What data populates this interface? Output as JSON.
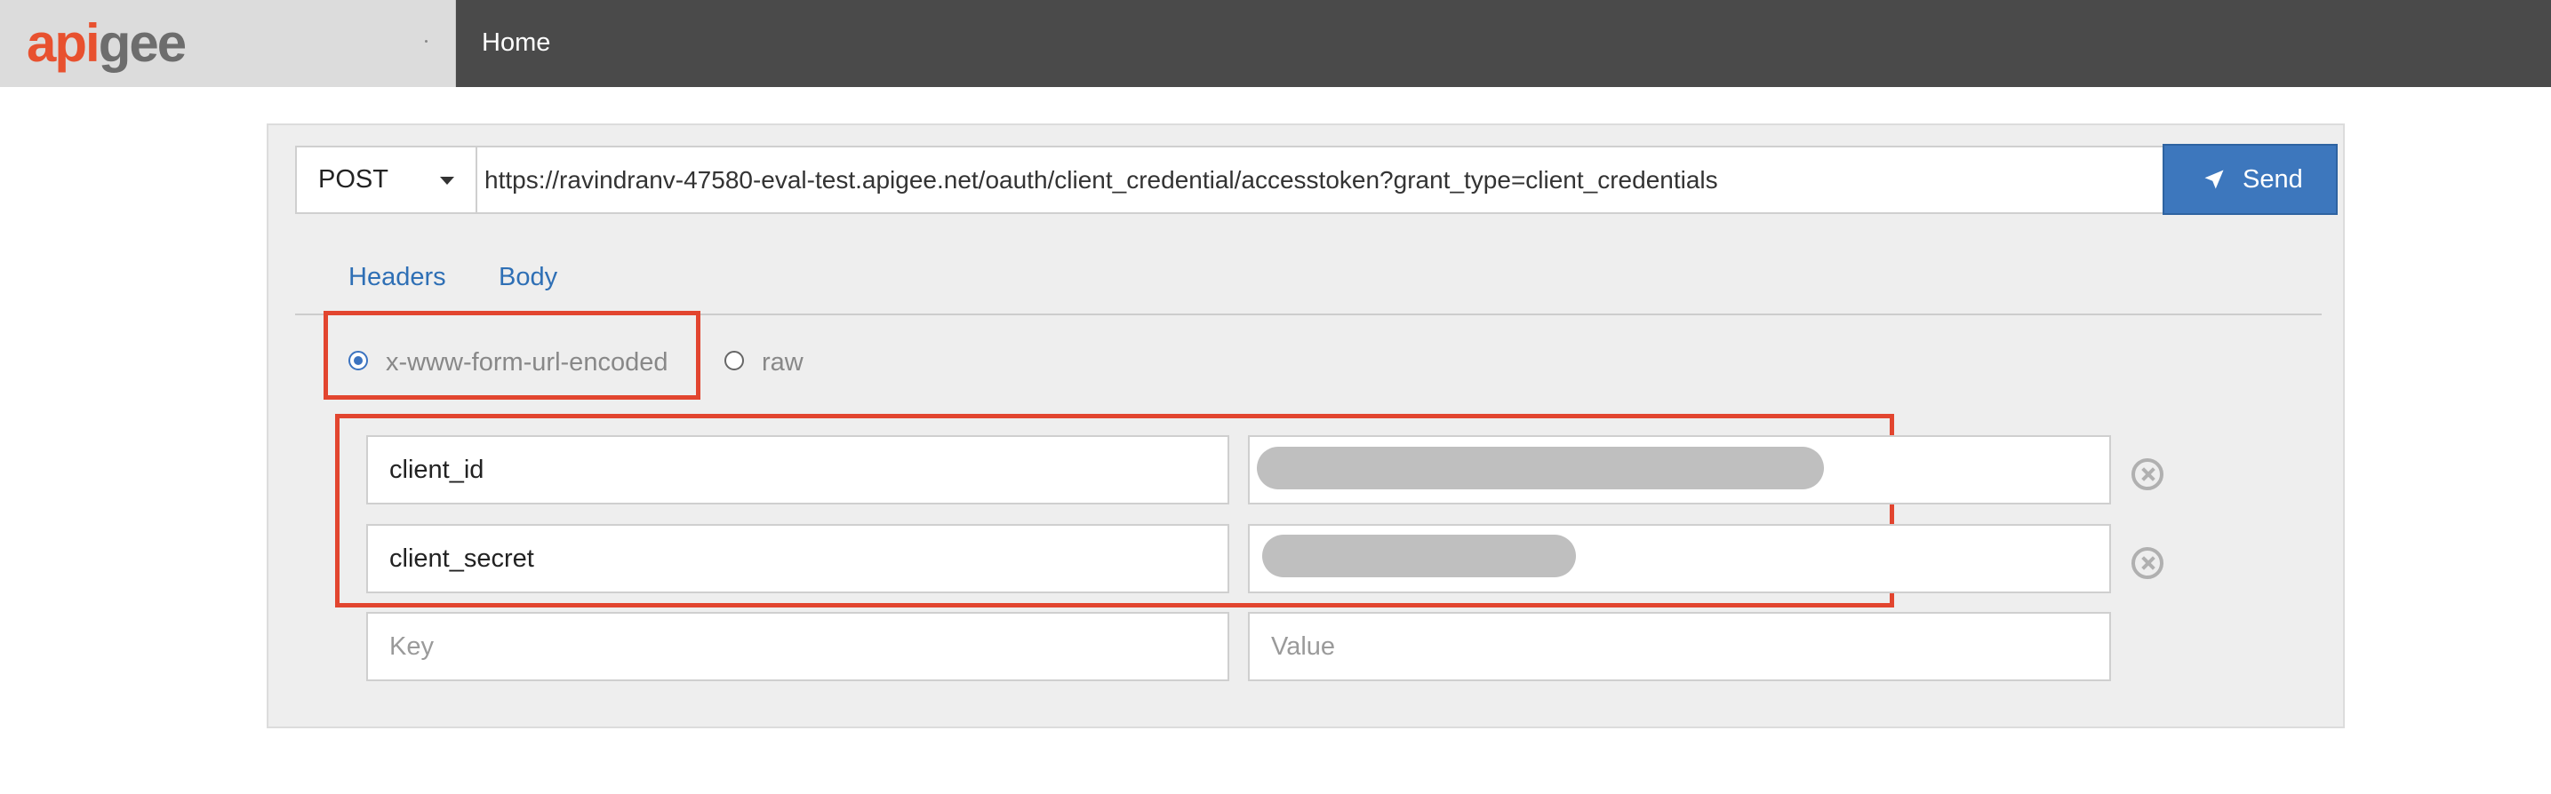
{
  "header": {
    "logo_api": "api",
    "logo_gee": "gee",
    "nav_home": "Home"
  },
  "request": {
    "method": "POST",
    "url": "https://ravindranv-47580-eval-test.apigee.net/oauth/client_credential/accesstoken?grant_type=client_credentials",
    "send_label": "Send"
  },
  "tabs": [
    {
      "label": "Headers"
    },
    {
      "label": "Body"
    }
  ],
  "body_type": {
    "options": [
      {
        "label": "x-www-form-url-encoded",
        "selected": true
      },
      {
        "label": "raw",
        "selected": false
      }
    ]
  },
  "form_fields": [
    {
      "key": "client_id",
      "value_redacted": true
    },
    {
      "key": "client_secret",
      "value_redacted": true
    }
  ],
  "new_field": {
    "key_placeholder": "Key",
    "value_placeholder": "Value"
  },
  "icons": {
    "send": "paper-plane-icon",
    "remove": "remove-circle-icon",
    "dropdown": "caret-down-icon"
  },
  "colors": {
    "topbar": "#4a4a4a",
    "logo_accent": "#e8512f",
    "send_button": "#3d77bd",
    "highlight": "#e2452f",
    "link": "#2e6fb5"
  }
}
